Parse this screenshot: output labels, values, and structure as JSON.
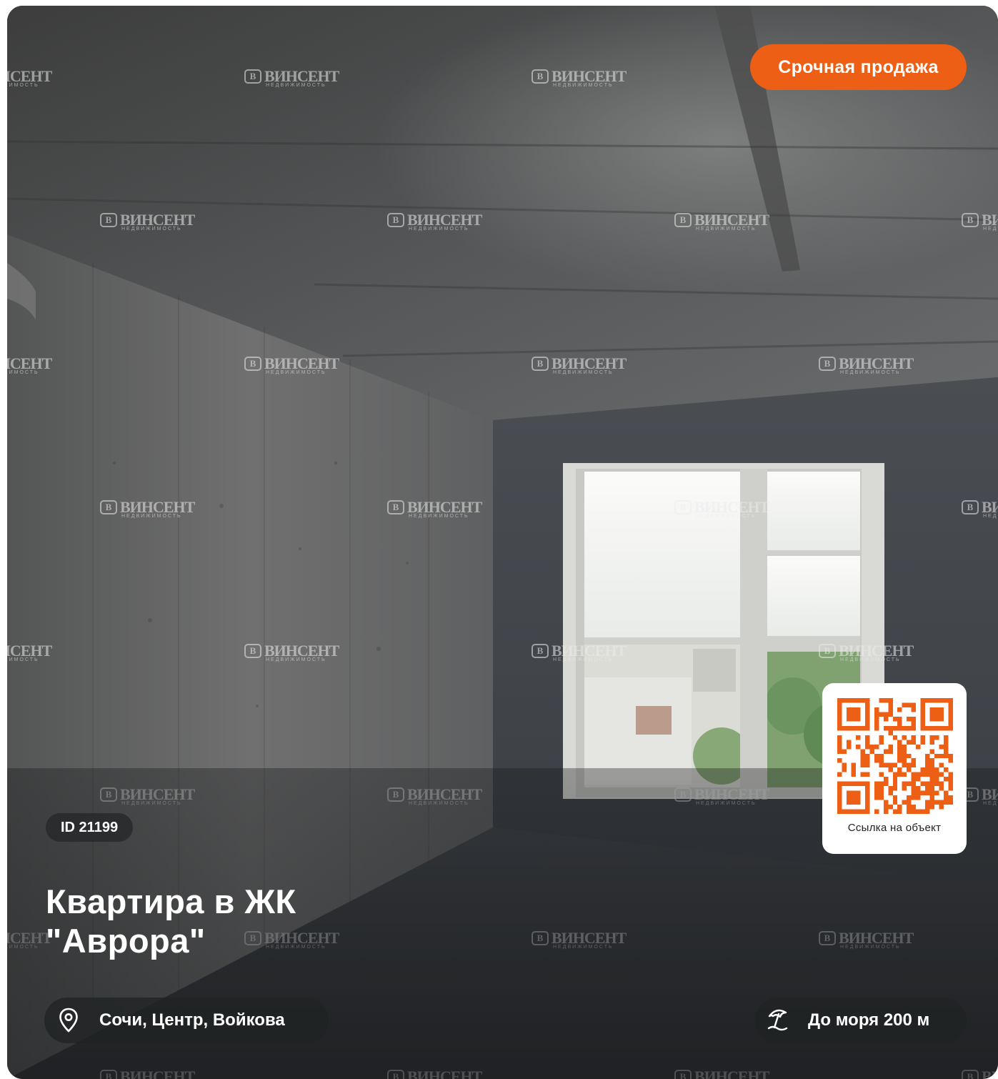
{
  "listing": {
    "badge": "Срочная продажа",
    "id_label": "ID 21199",
    "title_line1": "Квартира в ЖК",
    "title_line2": "\"Аврора\"",
    "address": "Сочи, Центр, Войкова",
    "sea_distance": "До моря 200 м",
    "qr_caption": "Ссылка на объект"
  },
  "watermark": {
    "name": "ВИНСЕНТ",
    "sub": "НЕДВИЖИМОСТЬ"
  },
  "icons": {
    "address": "map-pin-icon",
    "sea": "beach-umbrella-icon",
    "qr": "qr-code-icon"
  },
  "colors": {
    "accent": "#ec5f14",
    "chip_bg": "#202224",
    "qr_card_bg": "#ffffff"
  }
}
